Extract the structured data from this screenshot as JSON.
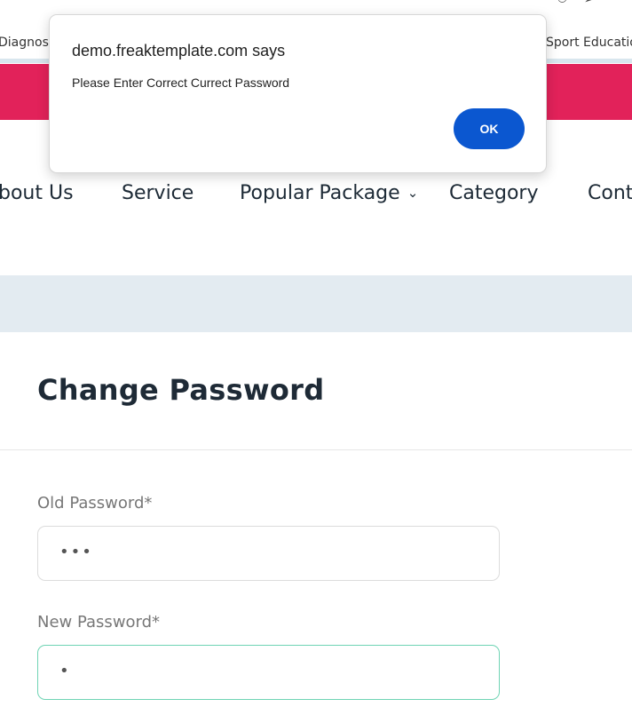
{
  "dialog": {
    "title": "demo.freaktemplate.com says",
    "message": "Please Enter Correct Currect Password",
    "ok_label": "OK"
  },
  "topbar": {
    "left_link": "Diagnost",
    "right_link": "Sport Educatio"
  },
  "nav": {
    "items": [
      "bout Us",
      "Service",
      "Popular Package",
      "Category",
      "Cont"
    ]
  },
  "form": {
    "title": "Change Password",
    "old_password_label": "Old Password*",
    "old_password_value": "•••",
    "new_password_label": "New Password*",
    "new_password_value": "•"
  },
  "colors": {
    "brand_pink": "#e2225a",
    "dialog_button": "#0b57d0",
    "focus_border": "#6fd4b4"
  },
  "icons": [
    "location-pin-icon",
    "send-icon",
    "chevron-down-icon"
  ]
}
